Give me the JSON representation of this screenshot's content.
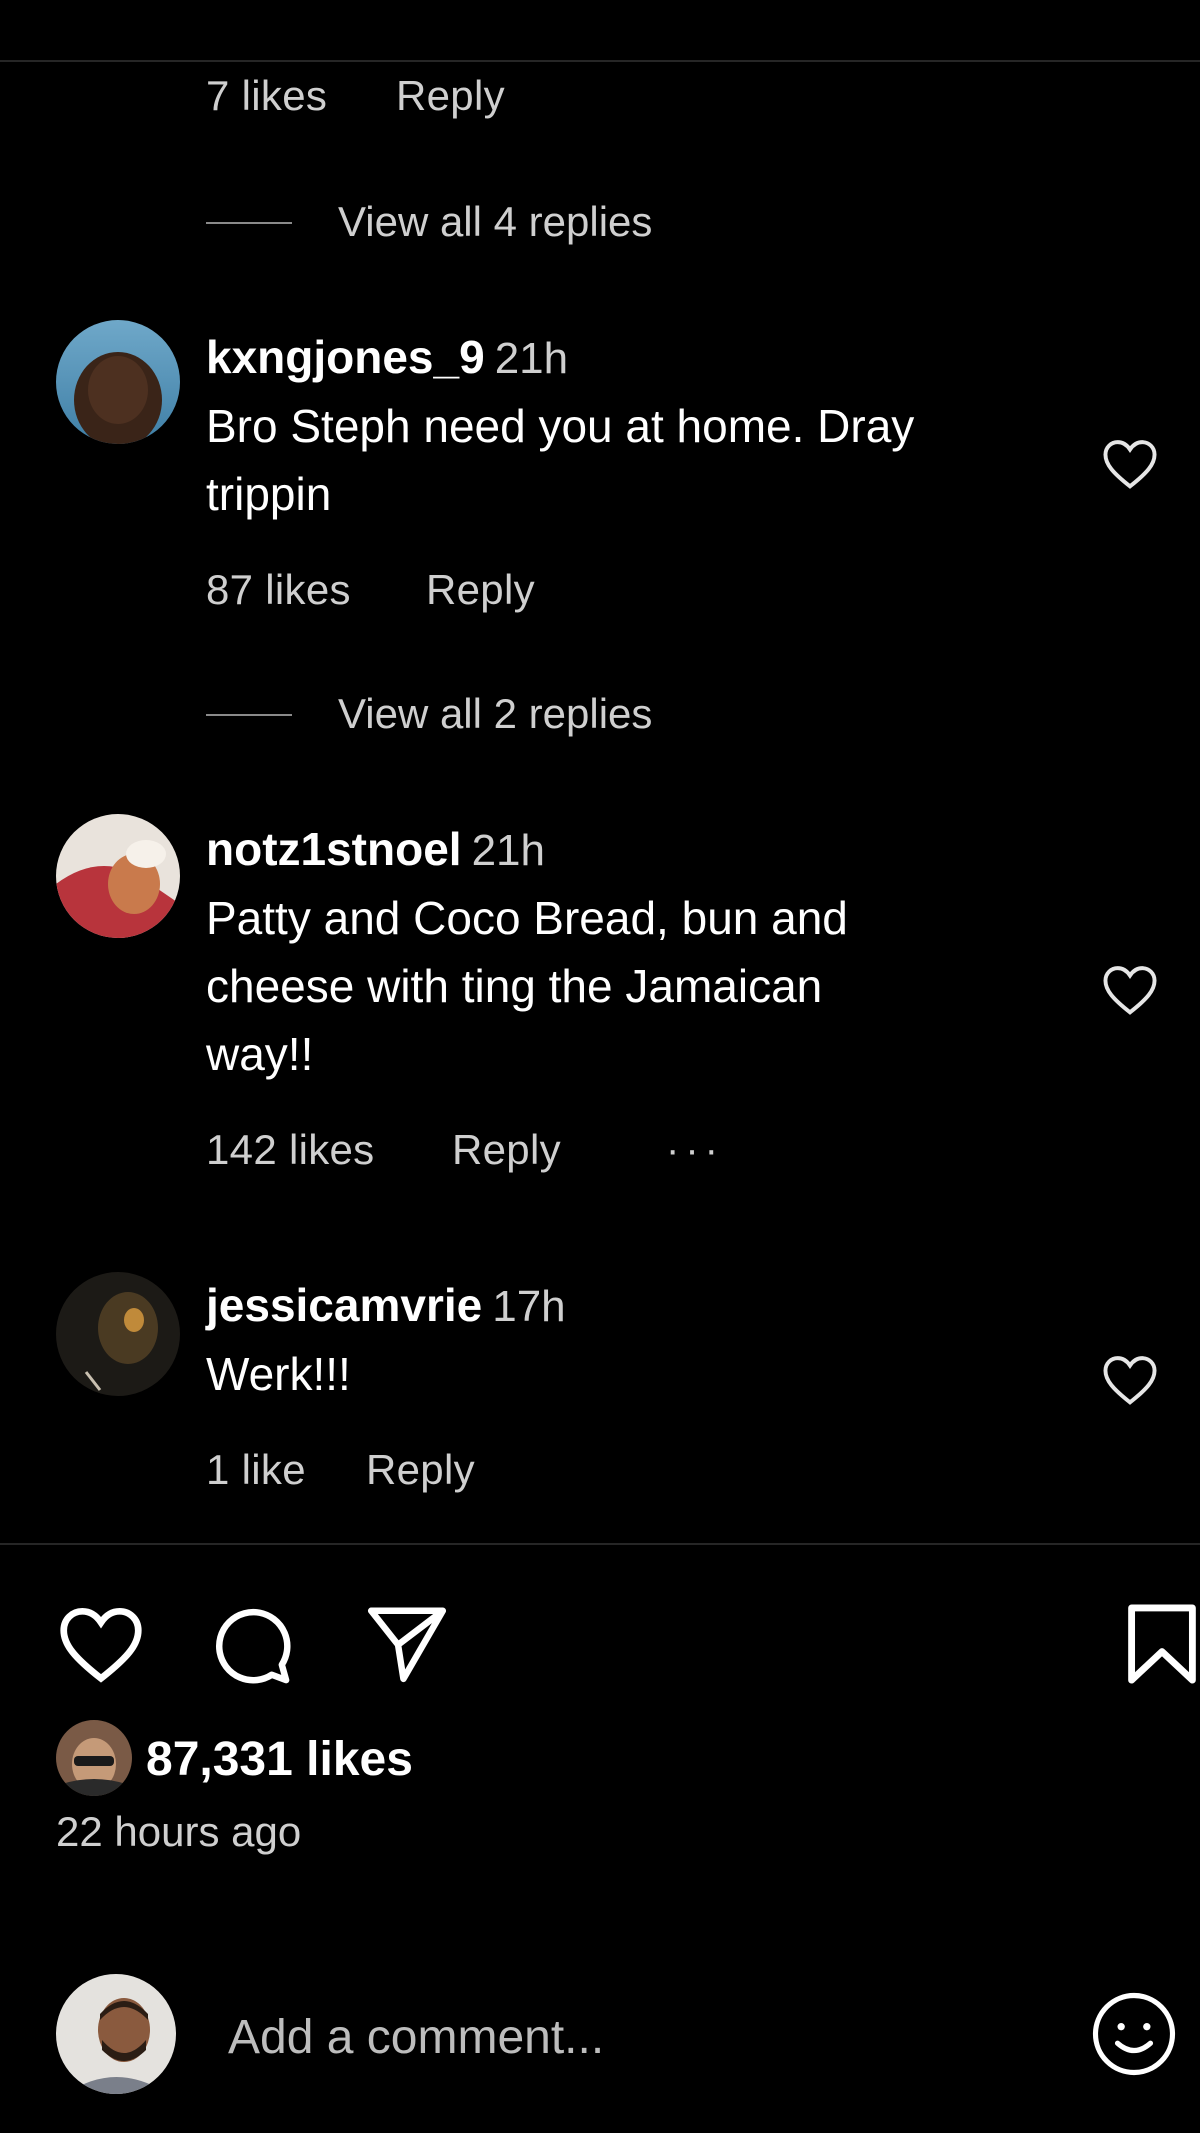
{
  "top_reply": {
    "likes": "7 likes",
    "reply": "Reply"
  },
  "comments": [
    {
      "view_replies": "View all 4 replies",
      "username": "kxngjones_9",
      "time": "21h",
      "lines": [
        "Bro Steph need you at home. Dray",
        "trippin"
      ],
      "likes": "87 likes",
      "reply": "Reply"
    },
    {
      "view_replies": "View all 2 replies",
      "username": "notz1stnoel",
      "time": "21h",
      "lines": [
        "Patty and Coco Bread, bun and",
        "cheese with ting the Jamaican",
        "way!!"
      ],
      "likes": "142 likes",
      "reply": "Reply",
      "more": "···"
    },
    {
      "username": "jessicamvrie",
      "time": "17h",
      "lines": [
        "Werk!!!"
      ],
      "likes": "1 like",
      "reply": "Reply"
    }
  ],
  "post": {
    "likes_total": "87,331 likes",
    "time_ago": "22 hours ago",
    "icons": [
      "heart-icon",
      "comment-icon",
      "share-icon",
      "bookmark-icon"
    ]
  },
  "composer": {
    "placeholder": "Add a comment...",
    "emoji_icon": "smiley-icon"
  }
}
